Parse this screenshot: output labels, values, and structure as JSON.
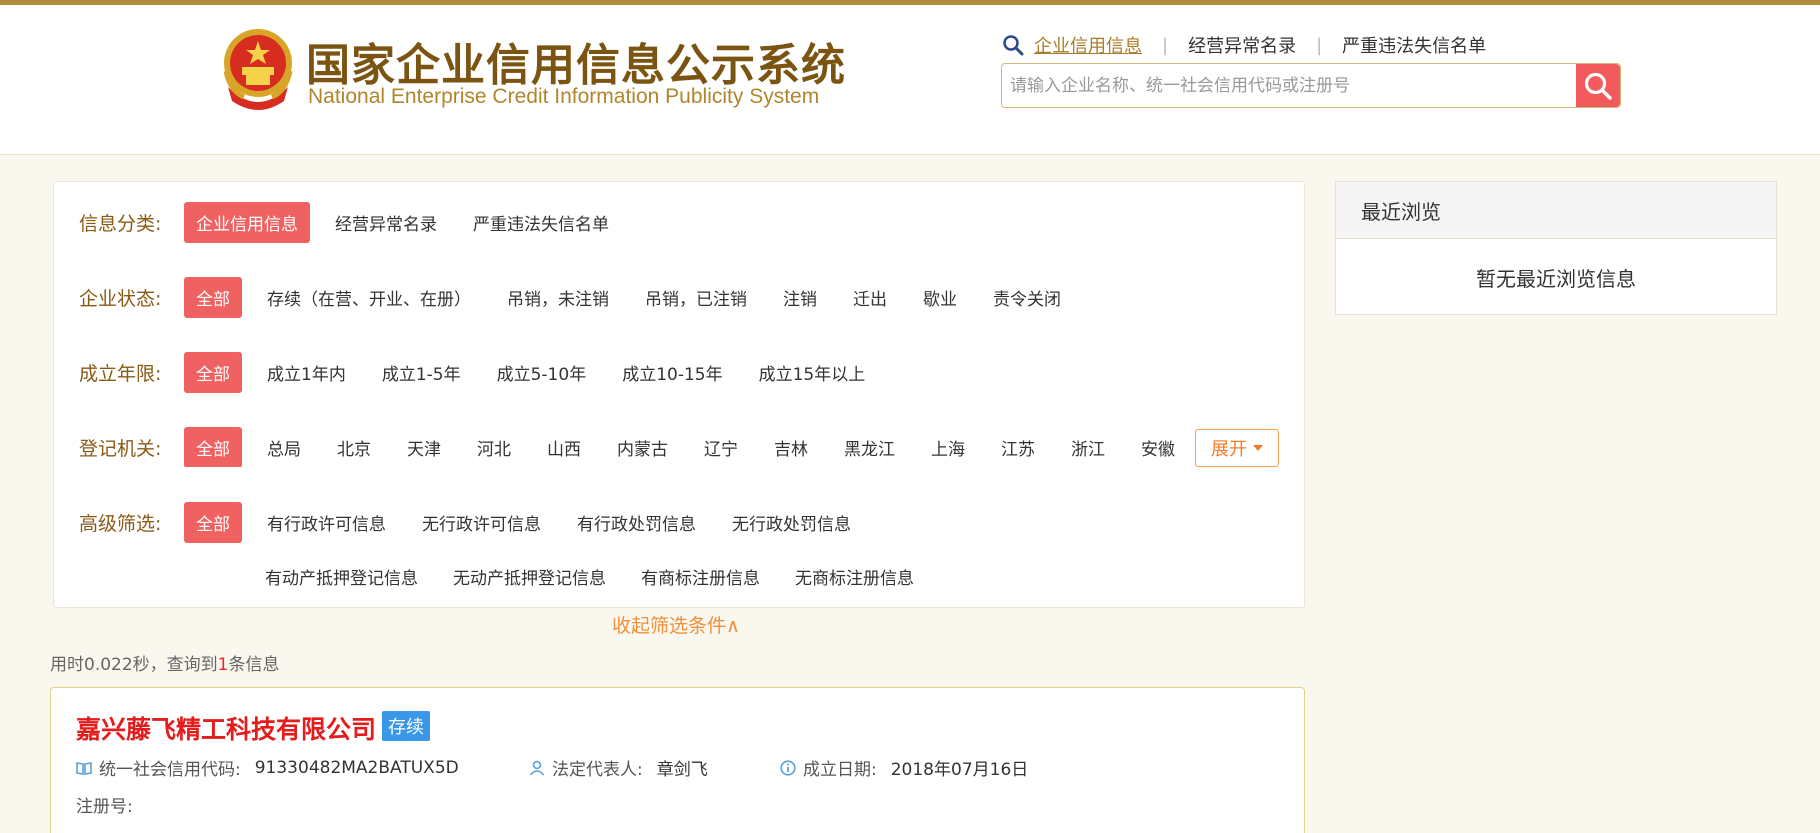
{
  "logo": {
    "title_cn": "国家企业信用信息公示系统",
    "title_en": "National Enterprise Credit Information Publicity System"
  },
  "topnav": {
    "items": [
      {
        "label": "企业信用信息",
        "active": true
      },
      {
        "label": "经营异常名录",
        "active": false
      },
      {
        "label": "严重违法失信名单",
        "active": false
      }
    ],
    "separator": "|"
  },
  "search": {
    "placeholder": "请输入企业名称、统一社会信用代码或注册号",
    "value": ""
  },
  "filters": {
    "category": {
      "label": "信息分类:",
      "options": [
        "企业信用信息",
        "经营异常名录",
        "严重违法失信名单"
      ],
      "selected": "企业信用信息"
    },
    "status": {
      "label": "企业状态:",
      "options": [
        "全部",
        "存续（在营、开业、在册）",
        "吊销，未注销",
        "吊销，已注销",
        "注销",
        "迁出",
        "歇业",
        "责令关闭"
      ],
      "selected": "全部"
    },
    "years": {
      "label": "成立年限:",
      "options": [
        "全部",
        "成立1年内",
        "成立1-5年",
        "成立5-10年",
        "成立10-15年",
        "成立15年以上"
      ],
      "selected": "全部"
    },
    "authority": {
      "label": "登记机关:",
      "options": [
        "全部",
        "总局",
        "北京",
        "天津",
        "河北",
        "山西",
        "内蒙古",
        "辽宁",
        "吉林",
        "黑龙江",
        "上海",
        "江苏",
        "浙江",
        "安徽"
      ],
      "selected": "全部",
      "expand_label": "展开"
    },
    "advanced": {
      "label": "高级筛选:",
      "selected": "全部",
      "options_line1": [
        "全部",
        "有行政许可信息",
        "无行政许可信息",
        "有行政处罚信息",
        "无行政处罚信息"
      ],
      "options_line2": [
        "有动产抵押登记信息",
        "无动产抵押登记信息",
        "有商标注册信息",
        "无商标注册信息"
      ]
    },
    "collapse_label": "收起筛选条件∧"
  },
  "results": {
    "time_prefix": "用时0.022秒，查询到",
    "count": "1",
    "count_suffix": "条信息",
    "items": [
      {
        "name": "嘉兴藤飞精工科技有限公司",
        "status": "存续",
        "credit_code_label": "统一社会信用代码:",
        "credit_code": "91330482MA2BATUX5D",
        "legal_rep_label": "法定代表人:",
        "legal_rep": "章剑飞",
        "founded_label": "成立日期:",
        "founded": "2018年07月16日",
        "reg_no_label": "注册号:"
      }
    ]
  },
  "recent": {
    "title": "最近浏览",
    "empty": "暂无最近浏览信息"
  },
  "colors": {
    "accent_red": "#f06262",
    "brand_gold": "#b08a3e",
    "label_brown": "#8a5a16",
    "link_orange": "#f0903a",
    "status_blue": "#3a96e6",
    "company_red": "#e41c1c"
  },
  "icons": {
    "emblem": "national-emblem-icon",
    "nav_search": "search-icon",
    "search_btn": "search-icon",
    "credit_code": "book-icon",
    "legal_rep": "user-icon",
    "founded": "info-icon",
    "expand": "caret-down-icon"
  }
}
